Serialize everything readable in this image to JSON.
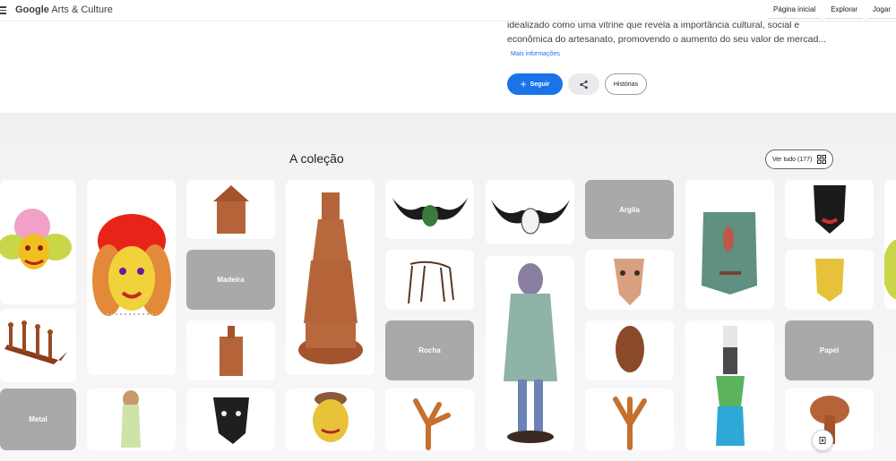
{
  "header": {
    "logo_google": "Google",
    "logo_rest": "Arts & Culture",
    "nav": [
      "Página inicial",
      "Explorar",
      "Jogar"
    ]
  },
  "intro": {
    "lines": [
      "idealizado como uma vitrine que revela a importância cultural, social e",
      "econômica do artesanato, promovendo o aumento do seu valor de mercad..."
    ],
    "more_link": "Mais informações",
    "follow_label": "Seguir",
    "stories_label": "Histórias"
  },
  "collection": {
    "title": "A coleção",
    "view_all": "Ver tudo (177)",
    "categories": {
      "madeira": "Madeira",
      "argila": "Argila",
      "rocha": "Rocha",
      "metal": "Metal",
      "papel": "Papel"
    }
  },
  "colors": {
    "accent": "#1a73e8",
    "category_tile": "#a9a9a9",
    "terracotta": "#b5643a"
  }
}
